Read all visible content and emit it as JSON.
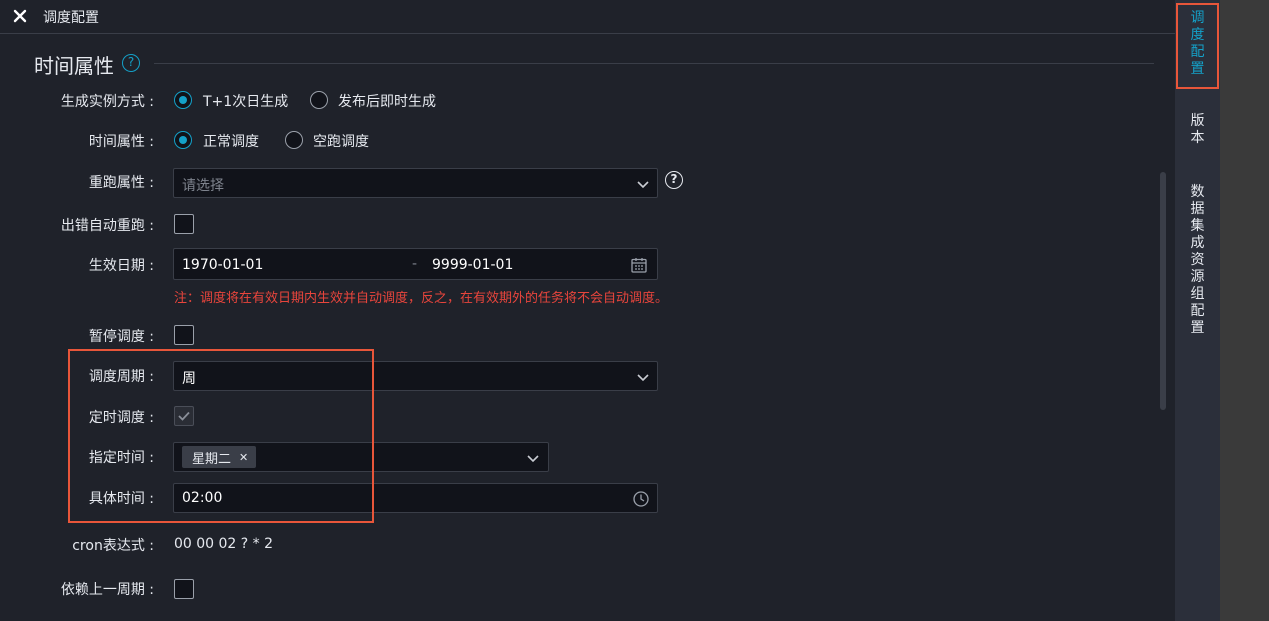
{
  "header": {
    "title": "调度配置"
  },
  "section": {
    "title": "时间属性"
  },
  "form": {
    "instance_mode": {
      "label": "生成实例方式",
      "option1": "T+1次日生成",
      "option2": "发布后即时生成"
    },
    "time_attr": {
      "label": "时间属性",
      "option1": "正常调度",
      "option2": "空跑调度"
    },
    "rerun_attr": {
      "label": "重跑属性",
      "placeholder": "请选择"
    },
    "auto_rerun": {
      "label": "出错自动重跑"
    },
    "effective_date": {
      "label": "生效日期",
      "start": "1970-01-01",
      "separator": "-",
      "end": "9999-01-01"
    },
    "note": "注：调度将在有效日期内生效并自动调度，反之，在有效期外的任务将不会自动调度。",
    "pause": {
      "label": "暂停调度"
    },
    "cycle": {
      "label": "调度周期",
      "value": "周"
    },
    "timed": {
      "label": "定时调度"
    },
    "specified_time": {
      "label": "指定时间",
      "tag": "星期二"
    },
    "exact_time": {
      "label": "具体时间",
      "value": "02:00"
    },
    "cron": {
      "label": "cron表达式",
      "value": "00 00 02 ? * 2"
    },
    "depend_prev": {
      "label": "依赖上一周期"
    }
  },
  "right_tabs": [
    {
      "label": "调度配置"
    },
    {
      "label": "版本"
    },
    {
      "label": "数据集成资源组配置"
    }
  ],
  "colors": {
    "accent": "#14a1c9",
    "highlight": "#e8563a",
    "warning": "#e8453c"
  }
}
